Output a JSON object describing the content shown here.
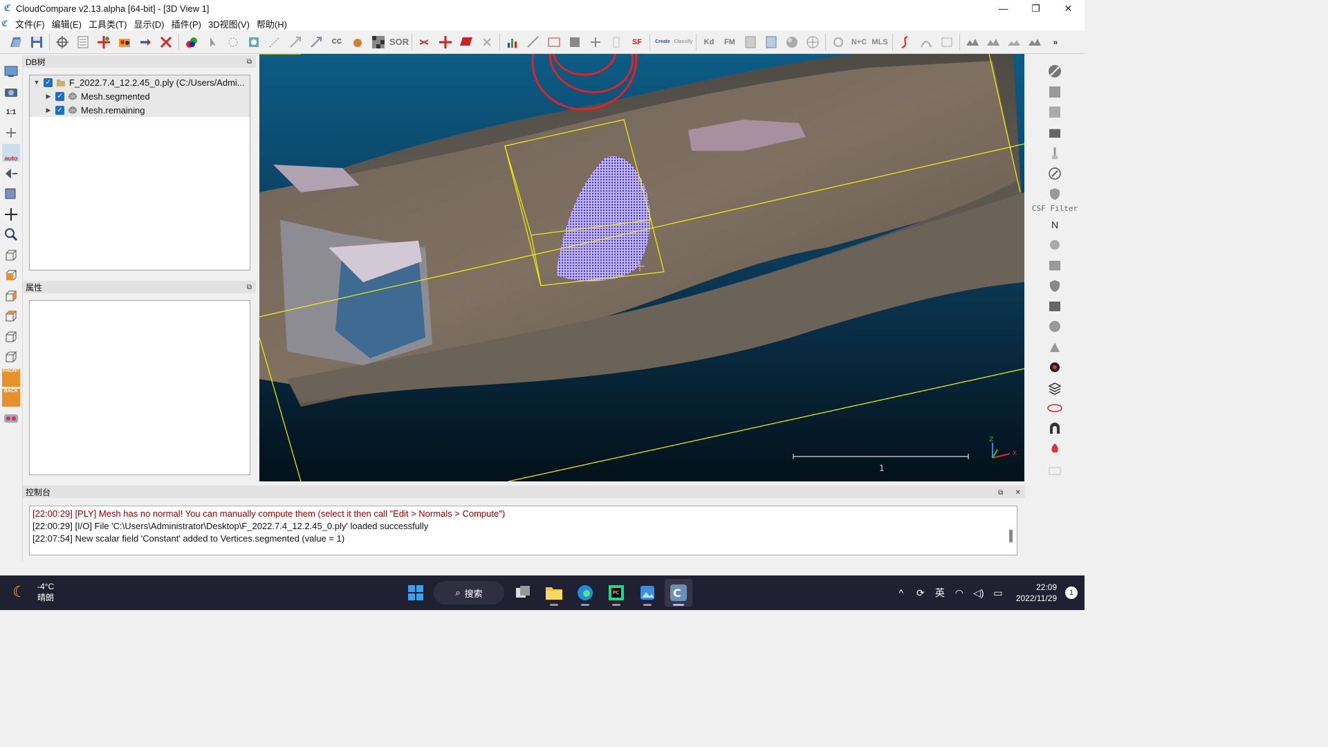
{
  "app": {
    "title": "CloudCompare v2.13.alpha [64-bit] - [3D View 1]",
    "accent": "#1a73c9"
  },
  "window_controls": {
    "minimize": "—",
    "restore": "❐",
    "close": "✕"
  },
  "menu": {
    "items": [
      "文件(F)",
      "编辑(E)",
      "工具类(T)",
      "显示(D)",
      "插件(P)",
      "3D视图(V)",
      "帮助(H)"
    ]
  },
  "toolbar": {
    "labels": {
      "sor": "SOR",
      "cc": "CC",
      "sf": "SF",
      "canupo_create": "Create",
      "canupo_classify": "Classify",
      "kd": "Kd",
      "fm": "FM",
      "nc": "N+C",
      "mls": "MLS"
    },
    "icons": [
      "open-icon",
      "save-icon",
      "global-shift-icon",
      "list-icon",
      "merge-icon",
      "segment-icon",
      "translate-icon",
      "delete-icon",
      "sample-icon",
      "pick-icon",
      "fine-register-icon",
      "density-icon",
      "noise-icon",
      "normals-icon",
      "cc-icon",
      "color-icon",
      "checker-icon",
      "sor-icon",
      "scissors-icon",
      "transform-icon",
      "plane-icon",
      "distance-icon",
      "histogram-icon",
      "filter-icon",
      "minmax-icon",
      "gradient-icon",
      "cross-icon",
      "box-icon",
      "sf-icon",
      "canupo-create-icon",
      "canupo-classify-icon",
      "kd-icon",
      "fm-icon",
      "export-icon",
      "csv-icon",
      "sphere-icon",
      "grid-icon",
      "puzzle-icon",
      "nc-icon",
      "mls-icon",
      "curve-icon",
      "scatter-icon",
      "compare-icon",
      "terrain1-icon",
      "terrain2-icon",
      "terrain3-icon",
      "terrain4-icon",
      "more-icon"
    ]
  },
  "left_toolbar": {
    "labels": {
      "zoom_ratio": "1:1",
      "auto": "auto",
      "front": "FRONT",
      "back": "BACK"
    }
  },
  "right_toolbar": {
    "csf_label": "CSF Filter",
    "north_label": "N"
  },
  "db_tree": {
    "title": "DB树",
    "root": "F_2022.7.4_12.2.45_0.ply (C:/Users/Admi...",
    "children": [
      "Mesh.segmented",
      "Mesh.remaining"
    ]
  },
  "properties": {
    "title": "属性"
  },
  "view3d": {
    "scale_label": "1",
    "axis_z": "Z",
    "axis_x": "X",
    "colors": {
      "sky_top": "#0c5c86",
      "sky_bottom": "#03111a",
      "bbox": "#f2f200",
      "points": "#4a44e0",
      "annotation": "#e52222"
    }
  },
  "console": {
    "title": "控制台",
    "lines": [
      {
        "text": "[22:00:29] [PLY] Mesh has no normal! You can manually compute them (select it then call \"Edit > Normals > Compute\")",
        "level": "warning"
      },
      {
        "text": "[22:00:29] [I/O] File 'C:\\Users\\Administrator\\Desktop\\F_2022.7.4_12.2.45_0.ply' loaded successfully",
        "level": "info"
      },
      {
        "text": "[22:07:54] New scalar field 'Constant' added to Vertices.segmented (value = 1)",
        "level": "info"
      }
    ]
  },
  "taskbar": {
    "weather_temp": "-4°C",
    "weather_desc": "晴朗",
    "search_label": "搜索",
    "ime": "英",
    "time": "22:09",
    "date": "2022/11/29",
    "notification_count": "1"
  }
}
